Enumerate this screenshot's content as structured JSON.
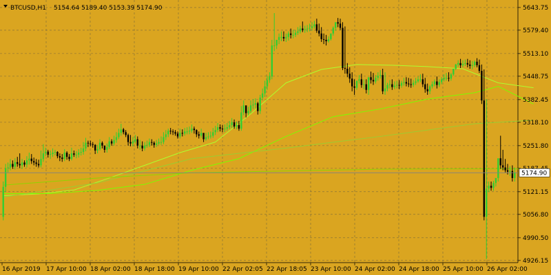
{
  "window": {
    "symbol_timeframe": "BTCUSD,H1",
    "ohlc": "5154.64 5189.40 5153.39 5174.90",
    "menu_icon": "triangle-down-icon"
  },
  "colors": {
    "background": "#DAA520",
    "grid": "#7A6A3A",
    "candle_up": "#32CD32",
    "candle_down": "#000000",
    "ma_fast": "#ADFF2F",
    "ma_medium": "#7CFC00",
    "ma_slow": "#9ACD32",
    "ma_long": "#8FD400",
    "price_line": "#808080",
    "text": "#000000"
  },
  "chart_data": {
    "type": "candlestick",
    "symbol": "BTCUSD",
    "timeframe": "H1",
    "y_ticks": [
      "5643.75",
      "5579.40",
      "5513.10",
      "5448.75",
      "5382.45",
      "5318.10",
      "5251.80",
      "5187.45",
      "5121.15",
      "5056.80",
      "4990.50",
      "4926.15"
    ],
    "ylim": [
      4920,
      5665
    ],
    "x_ticks": [
      "16 Apr 2019",
      "17 Apr 10:00",
      "18 Apr 02:00",
      "18 Apr 18:00",
      "19 Apr 10:00",
      "22 Apr 02:05",
      "22 Apr 18:05",
      "23 Apr 10:00",
      "24 Apr 02:00",
      "24 Apr 18:00",
      "25 Apr 10:00",
      "26 Apr 02:00"
    ],
    "current_price": "5174.90",
    "candles": {
      "open": [
        5050,
        5135,
        5188,
        5190,
        5200,
        5192,
        5205,
        5200,
        5196,
        5204,
        5198,
        5210,
        5215,
        5208,
        5204,
        5200,
        5196,
        5214,
        5230,
        5235,
        5226,
        5228,
        5232,
        5234,
        5222,
        5218,
        5214,
        5232,
        5220,
        5214,
        5230,
        5226,
        5226,
        5232,
        5234,
        5244,
        5260,
        5258,
        5256,
        5254,
        5238,
        5242,
        5260,
        5252,
        5240,
        5248,
        5264,
        5258,
        5268,
        5276,
        5288,
        5298,
        5290,
        5282,
        5262,
        5258,
        5264,
        5270,
        5252,
        5252,
        5244,
        5252,
        5254,
        5262,
        5260,
        5254,
        5258,
        5262,
        5262,
        5276,
        5284,
        5294,
        5292,
        5290,
        5286,
        5278,
        5288,
        5286,
        5292,
        5292,
        5294,
        5300,
        5296,
        5284,
        5280,
        5288,
        5270,
        5276,
        5278,
        5280,
        5290,
        5296,
        5304,
        5300,
        5298,
        5300,
        5304,
        5310,
        5318,
        5306,
        5310,
        5300,
        5346,
        5366,
        5344,
        5350,
        5366,
        5368,
        5372,
        5350,
        5388,
        5400,
        5420,
        5438,
        5448,
        5536,
        5536,
        5552,
        5560,
        5560,
        5556,
        5560,
        5570,
        5566,
        5566,
        5572,
        5576,
        5584,
        5580,
        5582,
        5584,
        5586,
        5590,
        5596,
        5578,
        5570,
        5554,
        5552,
        5548,
        5554,
        5570,
        5586,
        5602,
        5598,
        5586,
        5472,
        5470,
        5456,
        5442,
        5420,
        5416,
        5436,
        5440,
        5424,
        5426,
        5410,
        5446,
        5438,
        5434,
        5444,
        5450,
        5452,
        5406,
        5414,
        5424,
        5426,
        5418,
        5422,
        5424,
        5422,
        5430,
        5432,
        5428,
        5426,
        5424,
        5430,
        5434,
        5440,
        5440,
        5426,
        5412,
        5406,
        5420,
        5426,
        5434,
        5424,
        5432,
        5440,
        5444,
        5444,
        5442,
        5454,
        5470,
        5482,
        5486,
        5480,
        5484,
        5486,
        5482,
        5478,
        5480,
        5490,
        5480,
        5464,
        5380,
        5050,
        5130,
        5138,
        5132,
        5146,
        5160,
        5216,
        5196,
        5190,
        5182,
        5178,
        5180,
        5160
      ],
      "close": [
        5135,
        5188,
        5190,
        5200,
        5192,
        5205,
        5200,
        5196,
        5204,
        5198,
        5210,
        5215,
        5208,
        5204,
        5200,
        5196,
        5214,
        5230,
        5235,
        5226,
        5228,
        5232,
        5234,
        5222,
        5218,
        5214,
        5232,
        5220,
        5214,
        5230,
        5226,
        5226,
        5232,
        5234,
        5244,
        5260,
        5258,
        5256,
        5254,
        5238,
        5242,
        5260,
        5252,
        5240,
        5248,
        5264,
        5258,
        5268,
        5276,
        5288,
        5298,
        5290,
        5282,
        5262,
        5258,
        5264,
        5270,
        5252,
        5252,
        5244,
        5252,
        5254,
        5262,
        5260,
        5254,
        5258,
        5262,
        5262,
        5276,
        5284,
        5294,
        5292,
        5290,
        5286,
        5278,
        5288,
        5286,
        5292,
        5292,
        5294,
        5300,
        5296,
        5284,
        5280,
        5288,
        5270,
        5276,
        5278,
        5280,
        5290,
        5296,
        5304,
        5300,
        5298,
        5300,
        5304,
        5310,
        5318,
        5306,
        5310,
        5300,
        5346,
        5366,
        5344,
        5350,
        5366,
        5368,
        5372,
        5350,
        5388,
        5400,
        5420,
        5438,
        5448,
        5536,
        5536,
        5552,
        5560,
        5560,
        5556,
        5560,
        5570,
        5566,
        5566,
        5572,
        5576,
        5584,
        5580,
        5582,
        5584,
        5586,
        5590,
        5596,
        5578,
        5570,
        5554,
        5552,
        5548,
        5554,
        5570,
        5586,
        5602,
        5598,
        5586,
        5472,
        5470,
        5456,
        5442,
        5420,
        5416,
        5436,
        5440,
        5424,
        5426,
        5410,
        5446,
        5438,
        5434,
        5444,
        5450,
        5452,
        5406,
        5414,
        5424,
        5426,
        5418,
        5422,
        5424,
        5422,
        5430,
        5432,
        5428,
        5426,
        5424,
        5430,
        5434,
        5440,
        5440,
        5426,
        5412,
        5406,
        5420,
        5426,
        5434,
        5424,
        5432,
        5440,
        5444,
        5444,
        5442,
        5454,
        5470,
        5482,
        5486,
        5480,
        5484,
        5486,
        5482,
        5478,
        5480,
        5490,
        5480,
        5464,
        5380,
        5050,
        5130,
        5138,
        5132,
        5146,
        5160,
        5216,
        5196,
        5190,
        5182,
        5178,
        5180,
        5160,
        5175
      ],
      "high": [
        5150,
        5200,
        5204,
        5214,
        5210,
        5216,
        5220,
        5230,
        5214,
        5210,
        5222,
        5232,
        5228,
        5218,
        5214,
        5212,
        5238,
        5256,
        5246,
        5240,
        5238,
        5244,
        5240,
        5236,
        5230,
        5228,
        5242,
        5236,
        5228,
        5246,
        5238,
        5236,
        5242,
        5246,
        5262,
        5274,
        5266,
        5266,
        5262,
        5256,
        5254,
        5270,
        5264,
        5250,
        5258,
        5276,
        5270,
        5280,
        5290,
        5300,
        5314,
        5302,
        5296,
        5286,
        5282,
        5276,
        5282,
        5278,
        5268,
        5264,
        5262,
        5266,
        5272,
        5270,
        5264,
        5268,
        5272,
        5278,
        5290,
        5296,
        5300,
        5302,
        5298,
        5296,
        5292,
        5300,
        5298,
        5302,
        5304,
        5306,
        5312,
        5306,
        5298,
        5292,
        5300,
        5286,
        5288,
        5290,
        5292,
        5302,
        5308,
        5316,
        5312,
        5310,
        5312,
        5316,
        5322,
        5330,
        5326,
        5320,
        5322,
        5364,
        5380,
        5362,
        5362,
        5380,
        5384,
        5386,
        5376,
        5396,
        5414,
        5436,
        5450,
        5460,
        5552,
        5628,
        5550,
        5570,
        5576,
        5576,
        5570,
        5576,
        5584,
        5580,
        5580,
        5588,
        5592,
        5604,
        5592,
        5594,
        5598,
        5602,
        5606,
        5612,
        5598,
        5588,
        5570,
        5566,
        5562,
        5570,
        5590,
        5598,
        5614,
        5612,
        5602,
        5590,
        5486,
        5474,
        5460,
        5440,
        5434,
        5452,
        5456,
        5440,
        5440,
        5428,
        5462,
        5458,
        5452,
        5460,
        5466,
        5470,
        5460,
        5430,
        5438,
        5440,
        5434,
        5436,
        5438,
        5436,
        5444,
        5446,
        5444,
        5442,
        5438,
        5444,
        5448,
        5454,
        5456,
        5444,
        5428,
        5424,
        5434,
        5440,
        5448,
        5440,
        5446,
        5454,
        5458,
        5460,
        5458,
        5470,
        5484,
        5494,
        5498,
        5494,
        5496,
        5498,
        5494,
        5492,
        5494,
        5500,
        5496,
        5482,
        5468,
        5384,
        5150,
        5150,
        5152,
        5160,
        5174,
        5280,
        5240,
        5214,
        5200,
        5194,
        5196,
        5190
      ],
      "low": [
        5040,
        5120,
        5176,
        5182,
        5186,
        5184,
        5192,
        5188,
        5186,
        5192,
        5190,
        5198,
        5200,
        5196,
        5192,
        5190,
        5190,
        5206,
        5222,
        5218,
        5214,
        5220,
        5224,
        5216,
        5208,
        5206,
        5208,
        5212,
        5208,
        5210,
        5220,
        5216,
        5218,
        5224,
        5226,
        5236,
        5248,
        5250,
        5246,
        5228,
        5230,
        5238,
        5244,
        5232,
        5232,
        5242,
        5252,
        5252,
        5260,
        5270,
        5280,
        5284,
        5276,
        5252,
        5250,
        5250,
        5258,
        5244,
        5240,
        5236,
        5238,
        5246,
        5248,
        5252,
        5246,
        5248,
        5254,
        5254,
        5256,
        5268,
        5276,
        5284,
        5282,
        5280,
        5272,
        5272,
        5278,
        5280,
        5284,
        5284,
        5288,
        5286,
        5276,
        5272,
        5274,
        5262,
        5266,
        5270,
        5272,
        5274,
        5282,
        5290,
        5292,
        5290,
        5290,
        5294,
        5298,
        5302,
        5300,
        5298,
        5294,
        5294,
        5338,
        5332,
        5338,
        5344,
        5356,
        5358,
        5340,
        5342,
        5380,
        5390,
        5410,
        5430,
        5440,
        5520,
        5526,
        5540,
        5548,
        5548,
        5546,
        5550,
        5556,
        5556,
        5560,
        5566,
        5570,
        5574,
        5572,
        5574,
        5576,
        5578,
        5584,
        5572,
        5562,
        5546,
        5540,
        5536,
        5544,
        5550,
        5564,
        5578,
        5588,
        5580,
        5466,
        5456,
        5446,
        5430,
        5406,
        5396,
        5410,
        5428,
        5416,
        5412,
        5400,
        5396,
        5428,
        5424,
        5428,
        5436,
        5442,
        5398,
        5396,
        5406,
        5414,
        5410,
        5412,
        5414,
        5412,
        5416,
        5422,
        5420,
        5418,
        5416,
        5418,
        5424,
        5430,
        5432,
        5418,
        5402,
        5396,
        5398,
        5414,
        5420,
        5414,
        5418,
        5426,
        5434,
        5436,
        5434,
        5436,
        5450,
        5466,
        5476,
        5472,
        5474,
        5478,
        5474,
        5470,
        5468,
        5474,
        5474,
        5458,
        5370,
        5040,
        4930,
        5120,
        5124,
        5124,
        5136,
        5150,
        5186,
        5182,
        5176,
        5170,
        5166,
        5150,
        5150
      ]
    },
    "moving_averages": [
      {
        "x": [
          0,
          15,
          30,
          45,
          60,
          75,
          90,
          105,
          120,
          135,
          150,
          165,
          180,
          195,
          210,
          225
        ],
        "y": [
          5110,
          5115,
          5126,
          5160,
          5196,
          5232,
          5262,
          5342,
          5430,
          5468,
          5482,
          5480,
          5476,
          5470,
          5430,
          5416
        ]
      },
      {
        "x": [
          0,
          20,
          40,
          60,
          80,
          100,
          120,
          140,
          160,
          180,
          200,
          210,
          225
        ],
        "y": [
          5116,
          5116,
          5125,
          5142,
          5182,
          5215,
          5278,
          5334,
          5356,
          5384,
          5402,
          5420,
          5370
        ]
      },
      {
        "x": [
          0,
          40,
          80,
          120,
          160,
          200,
          215,
          225
        ],
        "y": [
          5106,
          5146,
          5215,
          5245,
          5278,
          5314,
          5320,
          5324
        ]
      },
      {
        "x": [
          0,
          40,
          80,
          120,
          160,
          200,
          225
        ],
        "y": [
          5140,
          5160,
          5175,
          5180,
          5185,
          5186,
          5186
        ]
      }
    ]
  }
}
